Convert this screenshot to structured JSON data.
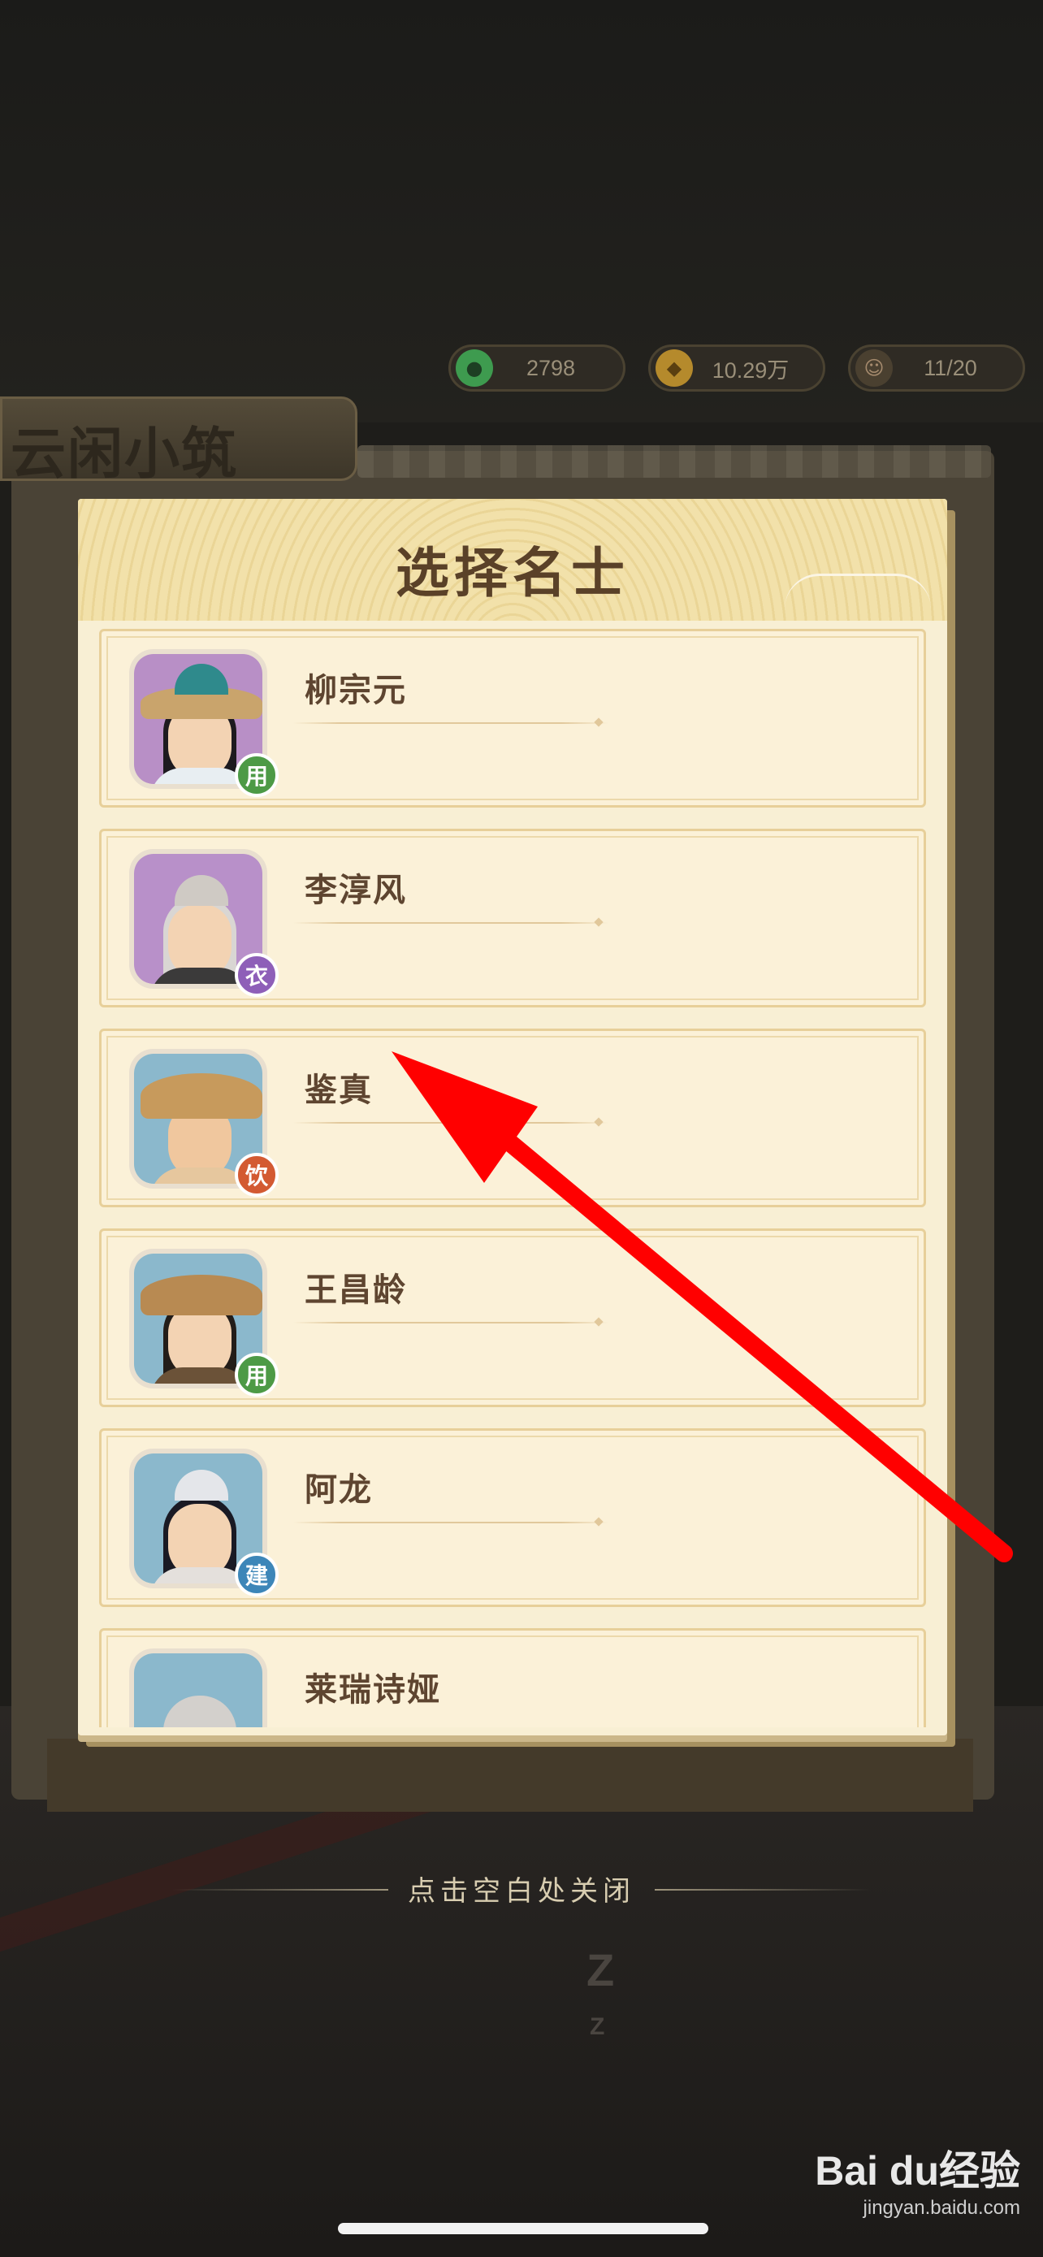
{
  "resources": [
    {
      "icon": "jade-coin-icon",
      "value": "2798",
      "color": "#3e9b4f"
    },
    {
      "icon": "copper-coin-icon",
      "value": "10.29万",
      "color": "#b58a2c"
    },
    {
      "icon": "person-icon",
      "value": "11/20",
      "color": "#a68b6e"
    }
  ],
  "location_title": "云闲小筑",
  "dialog": {
    "title": "选择名士",
    "items": [
      {
        "name": "柳宗元",
        "badge": "用",
        "badge_color": "#4d9a46",
        "avatar_bg": "#b88fc6"
      },
      {
        "name": "李淳风",
        "badge": "衣",
        "badge_color": "#8e5fb8",
        "avatar_bg": "#b890c9"
      },
      {
        "name": "鉴真",
        "badge": "饮",
        "badge_color": "#d35a32",
        "avatar_bg": "#8bb8cc"
      },
      {
        "name": "王昌龄",
        "badge": "用",
        "badge_color": "#4d9a46",
        "avatar_bg": "#8bb8cc"
      },
      {
        "name": "阿龙",
        "badge": "建",
        "badge_color": "#3d86b8",
        "avatar_bg": "#8bb8cc"
      },
      {
        "name": "莱瑞诗娅",
        "badge": "",
        "badge_color": "#8bb8cc",
        "avatar_bg": "#8bb8cc"
      }
    ]
  },
  "close_hint": "点击空白处关闭",
  "sleep_text": "Z",
  "watermark": {
    "logo": "Bai du经验",
    "url": "jingyan.baidu.com"
  },
  "annotation_color": "#ff0000"
}
